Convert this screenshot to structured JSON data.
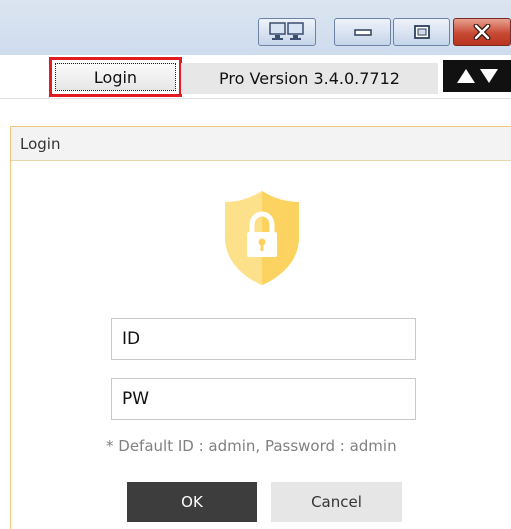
{
  "window": {
    "monitor_icon": "dual-monitor-icon",
    "minimize_icon": "minimize-icon",
    "maximize_icon": "maximize-icon",
    "close_icon": "close-icon"
  },
  "toolbar": {
    "login_label": "Login",
    "version_label": "Pro Version 3.4.0.7712",
    "arrows_icon": "up-down-arrows-icon",
    "highlight_color": "#e31b23"
  },
  "login_panel": {
    "header": "Login",
    "shield_icon": "lock-shield-icon",
    "shield_color": "#fdd86c",
    "id_placeholder": "ID",
    "pw_placeholder": "PW",
    "hint": "* Default ID : admin, Password : admin",
    "ok_label": "OK",
    "cancel_label": "Cancel"
  }
}
